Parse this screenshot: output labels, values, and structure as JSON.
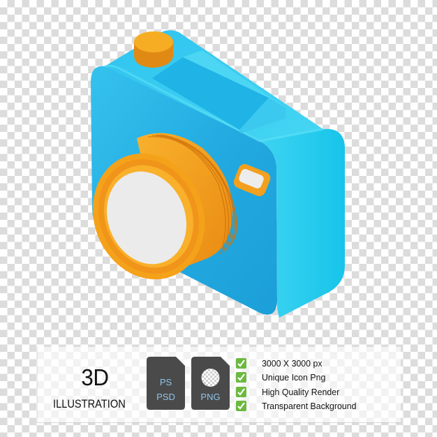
{
  "illustration": {
    "subject": "camera",
    "colors": {
      "body": "#26b4e6",
      "body_light": "#3fd0f0",
      "body_dark": "#1593c9",
      "accent": "#f5a21b",
      "accent_dark": "#e08510",
      "lens_cover": "#ececec"
    }
  },
  "banner": {
    "title_big": "3D",
    "title_small": "ILLUSTRATION",
    "files": [
      {
        "icon": "psd-file-icon",
        "lines": [
          "PS",
          "PSD"
        ]
      },
      {
        "icon": "png-file-icon",
        "lines": [
          "PNG"
        ]
      }
    ],
    "features": [
      {
        "icon": "check-icon",
        "text": "3000 X 3000 px"
      },
      {
        "icon": "check-icon",
        "text": "Unique Icon Png"
      },
      {
        "icon": "check-icon",
        "text": "High Quality Render"
      },
      {
        "icon": "check-icon",
        "text": "Transparent Background"
      }
    ],
    "colors": {
      "file_bg": "#4a4a4a",
      "file_text": "#8fc3ea",
      "check": "#6bb93f"
    }
  }
}
